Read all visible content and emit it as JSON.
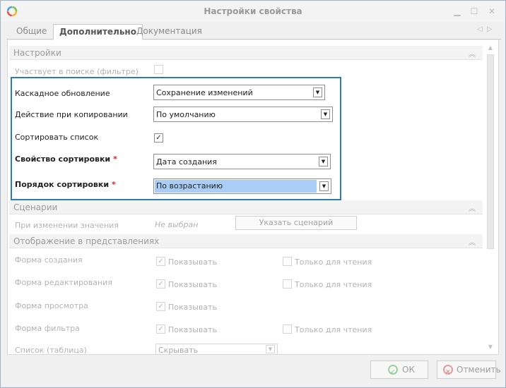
{
  "window": {
    "title": "Настройки свойства"
  },
  "tabs": [
    {
      "label": "Общие"
    },
    {
      "label": "Дополнительно"
    },
    {
      "label": "Документация"
    }
  ],
  "settings": {
    "header": "Настройки",
    "search_label": "Участвует в поиске (фильтре)",
    "cascade_label": "Каскадное обновление",
    "cascade_value": "Сохранение изменений",
    "copy_label": "Действие при копировании",
    "copy_value": "По умолчанию",
    "sort_label": "Сортировать список",
    "sort_checked": "✓",
    "sort_prop_label": "Свойство сортировки",
    "sort_prop_value": "Дата создания",
    "sort_order_label": "Порядок сортировки",
    "sort_order_value": "По возрастанию",
    "required_mark": "*"
  },
  "scenarios": {
    "header": "Сценарии",
    "on_change_label": "При изменении значения",
    "on_change_value": "Не выбран",
    "set_button": "Указать сценарий"
  },
  "views": {
    "header": "Отображение в представлениях",
    "rows": [
      {
        "label": "Форма создания",
        "show": "Показывать",
        "readonly": "Только для чтения"
      },
      {
        "label": "Форма редактирования",
        "show": "Показывать",
        "readonly": "Только для чтения"
      },
      {
        "label": "Форма просмотра",
        "show": "Показывать"
      },
      {
        "label": "Форма фильтра",
        "show": "Показывать",
        "readonly": "Только для чтения"
      }
    ],
    "list_label": "Список (таблица)",
    "list_value": "Скрывать",
    "check": "✓"
  },
  "footer": {
    "ok": "ОК",
    "cancel": "Отменить"
  }
}
